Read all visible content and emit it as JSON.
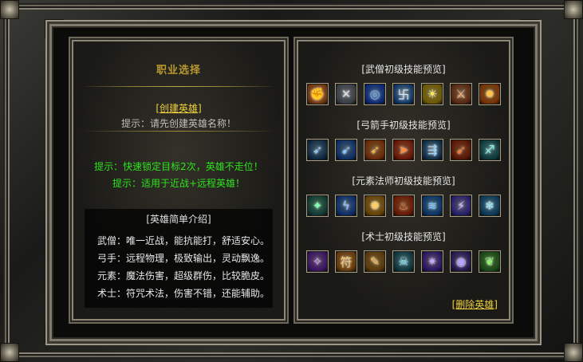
{
  "left": {
    "title": "职业选择",
    "create_hero": "[创建英雄]",
    "hint": "提示：请先创建英雄名称！",
    "tips": [
      "提示：快速锁定目标2次，英雄不走位！",
      "提示：适用于近战+远程英雄！"
    ],
    "intro_title": "[英雄简单介绍]",
    "intro_lines": [
      "武僧：唯一近战，能抗能打，舒适安心。",
      "弓手：远程物理，极致输出，灵动飘逸。",
      "元素：魔法伤害，超级群伤，比较脆皮。",
      "术士：符咒术法，伤害不错，还能辅助。"
    ]
  },
  "right": {
    "sections": [
      {
        "title": "[武僧初级技能预览]",
        "icons": [
          {
            "name": "flame-fist-icon",
            "glyph": "✊",
            "bg": "#7a3a10",
            "fg": "#ffb24a"
          },
          {
            "name": "cross-blades-icon",
            "glyph": "✕",
            "bg": "#3a4048",
            "fg": "#d8dde4"
          },
          {
            "name": "blue-vortex-icon",
            "glyph": "◎",
            "bg": "#0e2a7a",
            "fg": "#6ab4ff"
          },
          {
            "name": "swastika-seal-icon",
            "glyph": "卐",
            "bg": "#0f3a6a",
            "fg": "#cfe6ff"
          },
          {
            "name": "golden-aura-icon",
            "glyph": "☀",
            "bg": "#6e5a06",
            "fg": "#ffe860"
          },
          {
            "name": "halberd-icon",
            "glyph": "⚔",
            "bg": "#5a2a12",
            "fg": "#ffb070"
          },
          {
            "name": "fire-burst-icon",
            "glyph": "✹",
            "bg": "#7a3406",
            "fg": "#ffc24a"
          }
        ]
      },
      {
        "title": "[弓箭手初级技能预览]",
        "icons": [
          {
            "name": "bow-shot-icon",
            "glyph": "➶",
            "bg": "#102a44",
            "fg": "#8fd0ff"
          },
          {
            "name": "ice-arrow-icon",
            "glyph": "➹",
            "bg": "#0f2f66",
            "fg": "#86c8ff"
          },
          {
            "name": "fire-arrow-icon",
            "glyph": "➶",
            "bg": "#6a2a08",
            "fg": "#ffb040"
          },
          {
            "name": "flame-strike-icon",
            "glyph": "➤",
            "bg": "#6a1808",
            "fg": "#ff8a3a"
          },
          {
            "name": "multi-arrow-icon",
            "glyph": "⇶",
            "bg": "#10304a",
            "fg": "#9ad6ff"
          },
          {
            "name": "burning-spear-icon",
            "glyph": "➹",
            "bg": "#5a1606",
            "fg": "#ff7a30"
          },
          {
            "name": "archer-stance-icon",
            "glyph": "♐",
            "bg": "#0e3a3e",
            "fg": "#7ef0e8"
          }
        ]
      },
      {
        "title": "[元素法师初级技能预览]",
        "icons": [
          {
            "name": "green-orb-icon",
            "glyph": "✦",
            "bg": "#123a36",
            "fg": "#7dffb0"
          },
          {
            "name": "lightning-icon",
            "glyph": "ϟ",
            "bg": "#0e2e6a",
            "fg": "#8ac4ff"
          },
          {
            "name": "meteor-icon",
            "glyph": "✺",
            "bg": "#6a4406",
            "fg": "#ffd060"
          },
          {
            "name": "inferno-icon",
            "glyph": "♨",
            "bg": "#6a1a06",
            "fg": "#ff7a2a"
          },
          {
            "name": "water-wave-icon",
            "glyph": "≋",
            "bg": "#0c3466",
            "fg": "#6cc8ff"
          },
          {
            "name": "chain-lightning-icon",
            "glyph": "⚡",
            "bg": "#26206a",
            "fg": "#c6b8ff"
          },
          {
            "name": "frost-icon",
            "glyph": "❄",
            "bg": "#0c3a5a",
            "fg": "#9ae8ff"
          }
        ]
      },
      {
        "title": "[术士初级技能预览]",
        "icons": [
          {
            "name": "purple-hex-icon",
            "glyph": "✧",
            "bg": "#3a1460",
            "fg": "#d9a4ff"
          },
          {
            "name": "talisman-icon",
            "glyph": "符",
            "bg": "#6a3a0a",
            "fg": "#ffcc70"
          },
          {
            "name": "scroll-fire-icon",
            "glyph": "✎",
            "bg": "#5a3a0c",
            "fg": "#ffc050"
          },
          {
            "name": "soul-spirit-icon",
            "glyph": "☠",
            "bg": "#10363e",
            "fg": "#7ee8ff"
          },
          {
            "name": "arcane-burst-icon",
            "glyph": "✴",
            "bg": "#2a1660",
            "fg": "#c8a8ff"
          },
          {
            "name": "dark-orb-icon",
            "glyph": "◉",
            "bg": "#241850",
            "fg": "#b4a4ff"
          },
          {
            "name": "healing-leaf-icon",
            "glyph": "❦",
            "bg": "#1a4a16",
            "fg": "#8cf06a"
          }
        ]
      }
    ],
    "delete_hero": "[删除英雄]"
  }
}
